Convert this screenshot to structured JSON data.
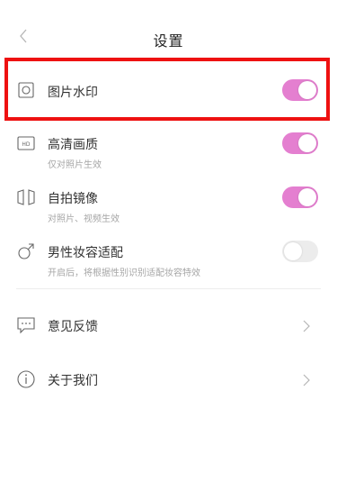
{
  "header": {
    "title": "设置",
    "back_icon": "chevron-left-icon"
  },
  "settings": [
    {
      "key": "watermark",
      "label": "图片水印",
      "subtitle": "",
      "icon": "square-icon",
      "enabled": true
    },
    {
      "key": "hd",
      "label": "高清画质",
      "subtitle": "仅对照片生效",
      "icon": "hd-icon",
      "enabled": true
    },
    {
      "key": "mirror",
      "label": "自拍镜像",
      "subtitle": "对照片、视频生效",
      "icon": "mirror-icon",
      "enabled": true
    },
    {
      "key": "male_makeup",
      "label": "男性妆容适配",
      "subtitle": "开启后，将根据性别识别适配妆容特效",
      "icon": "male-icon",
      "enabled": false
    }
  ],
  "links": [
    {
      "key": "feedback",
      "label": "意见反馈",
      "icon": "chat-icon"
    },
    {
      "key": "about",
      "label": "关于我们",
      "icon": "info-icon"
    }
  ],
  "colors": {
    "accent": "#e47fd0",
    "highlight": "#ee1111",
    "toggle_off": "#ececec"
  }
}
